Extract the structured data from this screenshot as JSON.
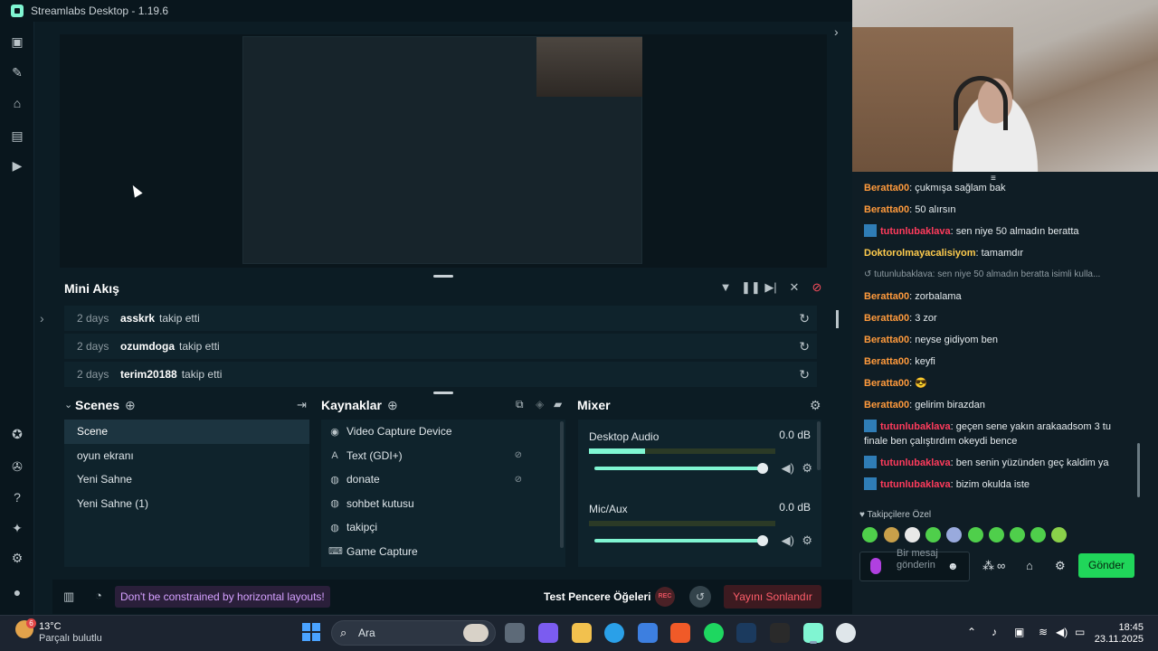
{
  "app": {
    "title": "Streamlabs Desktop - 1.19.6"
  },
  "mini_feed": {
    "title": "Mini Akış",
    "events": [
      {
        "time": "2 days",
        "user": "asskrk",
        "action": "takip etti"
      },
      {
        "time": "2 days",
        "user": "ozumdoga",
        "action": "takip etti"
      },
      {
        "time": "2 days",
        "user": "terim20188",
        "action": "takip etti"
      }
    ]
  },
  "scenes": {
    "title": "Scenes",
    "items": [
      "Scene",
      "oyun ekranı",
      "Yeni Sahne",
      "Yeni Sahne (1)"
    ],
    "selected": "Scene"
  },
  "sources": {
    "title": "Kaynaklar",
    "items": [
      {
        "label": "Video Capture Device",
        "icon": "camera-icon"
      },
      {
        "label": "Text (GDI+)",
        "icon": "text-icon"
      },
      {
        "label": "donate",
        "icon": "globe-icon"
      },
      {
        "label": "sohbet kutusu",
        "icon": "globe-icon"
      },
      {
        "label": "takipçi",
        "icon": "globe-icon"
      },
      {
        "label": "Game Capture",
        "icon": "gamepad-icon"
      }
    ]
  },
  "mixer": {
    "title": "Mixer",
    "channels": [
      {
        "name": "Desktop Audio",
        "db": "0.0 dB",
        "volume": 1.0
      },
      {
        "name": "Mic/Aux",
        "db": "0.0 dB",
        "volume": 1.0
      }
    ]
  },
  "footer": {
    "tip": "Don't be constrained by horizontal layouts!",
    "test_windows": "Test Pencere Öğeleri",
    "rec": "REC",
    "end_stream": "Yayını Sonlandır"
  },
  "chat": {
    "messages": [
      {
        "user": "Beratta00",
        "text": ": çukmışa sağlam bak",
        "color": "#ff9a3c",
        "badge": false
      },
      {
        "user": "Beratta00",
        "text": ": 50 alırsın",
        "color": "#ff9a3c",
        "badge": false
      },
      {
        "user": "tutunlubaklava",
        "text": ": sen niye 50 almadın beratta",
        "color": "#ff3b5c",
        "badge": true
      },
      {
        "user": "Doktorolmayacalisiyom",
        "text": ": tamamdır",
        "color": "#ffcc4d",
        "badge": false
      },
      {
        "user": "",
        "text": "tutunlubaklava: sen niye 50 almadın beratta isimli kulla...",
        "color": "#8d9aa1",
        "badge": false,
        "reply": true
      },
      {
        "user": "Beratta00",
        "text": ": zorbalama",
        "color": "#ff9a3c",
        "badge": false
      },
      {
        "user": "Beratta00",
        "text": ": 3 zor",
        "color": "#ff9a3c",
        "badge": false
      },
      {
        "user": "Beratta00",
        "text": ": neyse gidiyom ben",
        "color": "#ff9a3c",
        "badge": false
      },
      {
        "user": "Beratta00",
        "text": ": keyfi",
        "color": "#ff9a3c",
        "badge": false
      },
      {
        "user": "Beratta00",
        "text": ": 😎",
        "color": "#ff9a3c",
        "badge": false
      },
      {
        "user": "Beratta00",
        "text": ": gelirim birazdan",
        "color": "#ff9a3c",
        "badge": false
      },
      {
        "user": "tutunlubaklava",
        "text": ": geçen sene yakın arakaadsom 3 tu finale ben çalıştırdım okeydi bence",
        "color": "#ff3b5c",
        "badge": true
      },
      {
        "user": "tutunlubaklava",
        "text": ": ben senin yüzünden geç kaldim ya",
        "color": "#ff3b5c",
        "badge": true
      },
      {
        "user": "tutunlubaklava",
        "text": ": bizim okulda iste",
        "color": "#ff3b5c",
        "badge": true
      }
    ],
    "followers_only": "Takipçilere Özel",
    "input_placeholder": "Bir mesaj gönderin",
    "send": "Gönder"
  },
  "taskbar": {
    "temp": "13°C",
    "weather": "Parçalı bulutlu",
    "weather_badge": "6",
    "search": "Ara",
    "time": "18:45",
    "date": "23.11.2025"
  },
  "colors": {
    "accent": "#80f5d2",
    "send": "#20d65a",
    "end_stream": "#ff5e6a"
  }
}
